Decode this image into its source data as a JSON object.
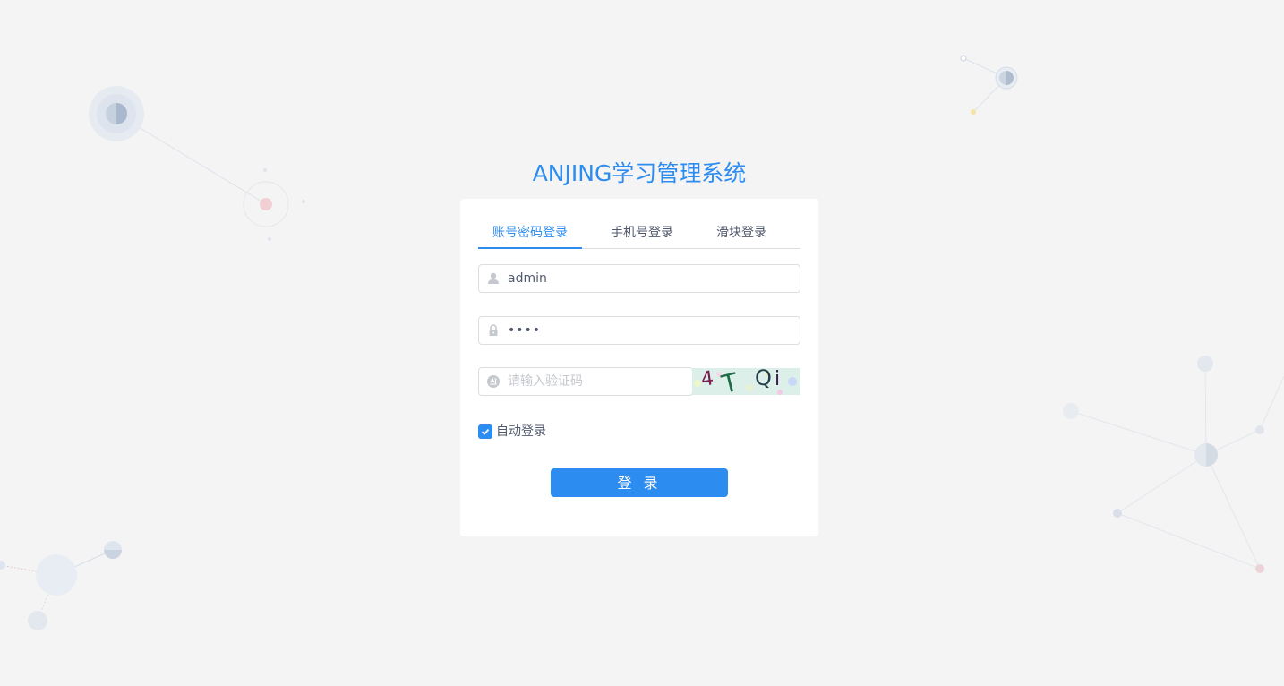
{
  "app": {
    "title": "ANJING学习管理系统"
  },
  "tabs": [
    {
      "label": "账号密码登录",
      "active": true
    },
    {
      "label": "手机号登录",
      "active": false
    },
    {
      "label": "滑块登录",
      "active": false
    }
  ],
  "form": {
    "username": {
      "value": "admin",
      "icon": "user-icon"
    },
    "password": {
      "value": "••••",
      "icon": "lock-icon"
    },
    "captcha": {
      "value": "",
      "placeholder": "请输入验证码",
      "icon": "captcha-icon",
      "image_text": "4T Qi"
    },
    "remember": {
      "label": "自动登录",
      "checked": true
    },
    "submit_label": "登 录"
  },
  "colors": {
    "accent": "#2d8cf0",
    "background": "#f4f4f5",
    "text": "#515a6e",
    "border": "#dcdee2"
  }
}
